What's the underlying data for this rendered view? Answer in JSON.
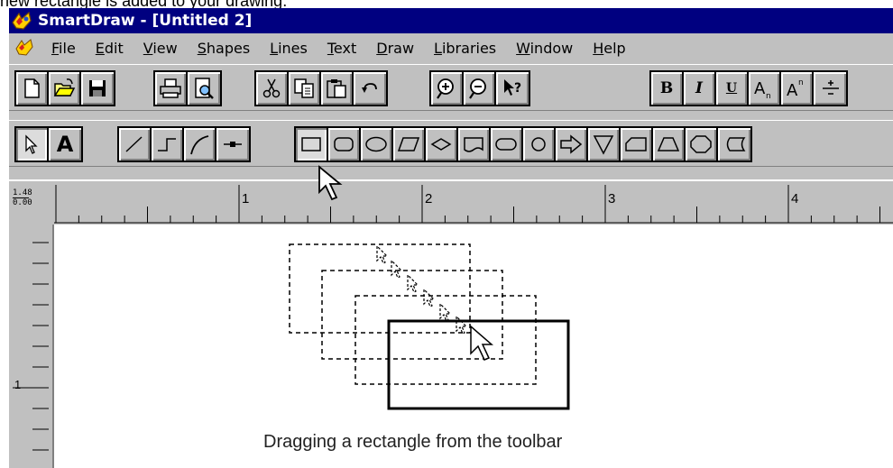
{
  "top_caption": "new rectangle is added to your drawing.",
  "window": {
    "title": "SmartDraw - [Untitled 2]",
    "colors": {
      "titlebar": "#000080",
      "face": "#c0c0c0"
    }
  },
  "menu": {
    "items": [
      {
        "label": "File",
        "key": "F"
      },
      {
        "label": "Edit",
        "key": "E"
      },
      {
        "label": "View",
        "key": "V"
      },
      {
        "label": "Shapes",
        "key": "S"
      },
      {
        "label": "Lines",
        "key": "L"
      },
      {
        "label": "Text",
        "key": "T"
      },
      {
        "label": "Draw",
        "key": "D"
      },
      {
        "label": "Libraries",
        "key": "L"
      },
      {
        "label": "Window",
        "key": "W"
      },
      {
        "label": "Help",
        "key": "H"
      }
    ]
  },
  "toolbar_standard": {
    "icons": [
      "new-icon",
      "open-icon",
      "save-icon",
      "print-icon",
      "print-preview-icon",
      "cut-icon",
      "copy-icon",
      "paste-icon",
      "undo-icon",
      "zoom-in-icon",
      "zoom-out-icon",
      "context-help-icon",
      "bold-icon",
      "italic-icon",
      "underline-icon",
      "subscript-icon",
      "superscript-icon",
      "fraction-icon"
    ],
    "bold": "B",
    "italic": "I",
    "underline": "U"
  },
  "toolbar_shapes": {
    "icons": [
      "pointer-icon",
      "text-tool-icon",
      "line-icon",
      "elbow-line-icon",
      "curve-icon",
      "connector-icon",
      "rectangle-icon",
      "rounded-rectangle-icon",
      "ellipse-icon",
      "parallelogram-icon",
      "diamond-icon",
      "document-icon",
      "terminator-icon",
      "circle-icon",
      "arrow-icon",
      "triangle-icon",
      "card-icon",
      "trapezoid-icon",
      "octagon-icon",
      "storage-icon"
    ],
    "text_tool": "A",
    "selected": "rectangle-icon"
  },
  "ruler": {
    "corner_top": "1.48",
    "corner_bottom": "0.00",
    "labels": [
      "1",
      "2",
      "3",
      "4"
    ],
    "vertical_label": "1"
  },
  "canvas": {
    "caption": "Dragging a rectangle from the toolbar"
  }
}
